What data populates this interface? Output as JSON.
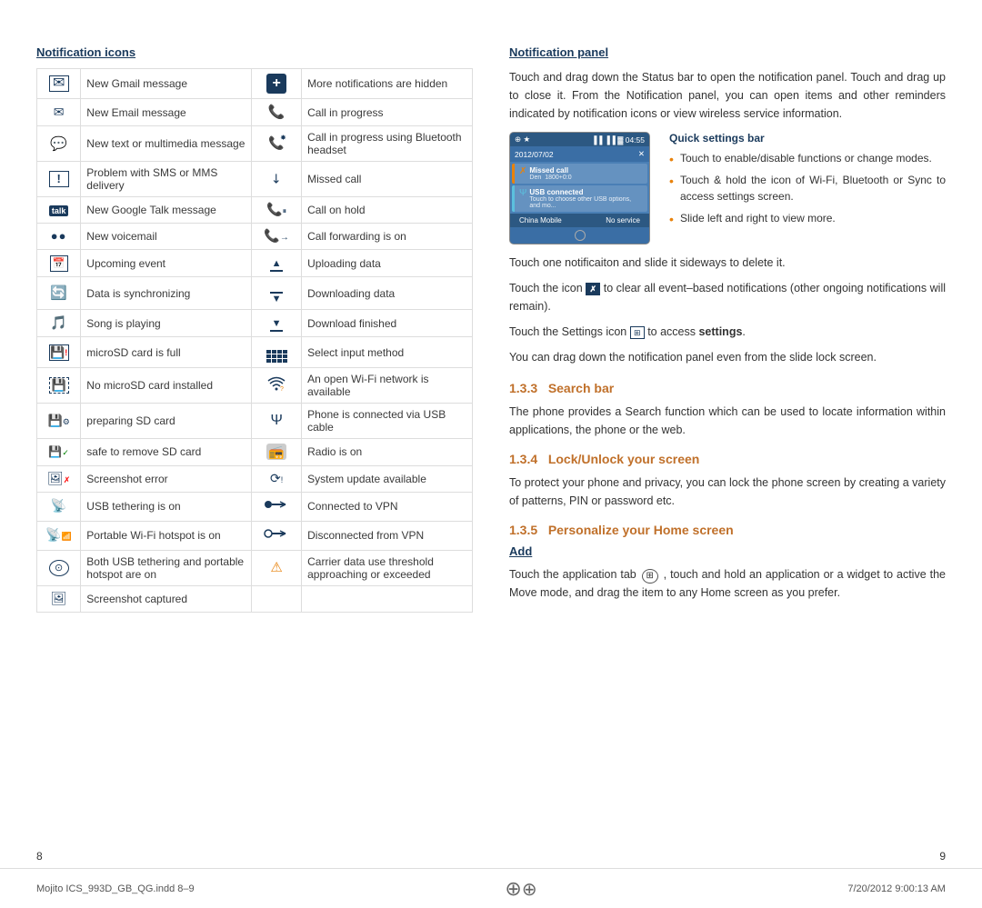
{
  "page": {
    "left_page_num": "8",
    "right_page_num": "9",
    "footer_text": "Mojito ICS_993D_GB_QG.indd   8–9",
    "footer_date": "7/20/2012   9:00:13 AM"
  },
  "left_section": {
    "title": "Notification icons",
    "rows": [
      {
        "icon_left": "✉",
        "label_left": "New Gmail message",
        "icon_right": "+",
        "label_right": "More notifications are hidden",
        "icon_right_style": "plus-circle"
      },
      {
        "icon_left": "✉",
        "label_left": "New Email message",
        "icon_right": "📞",
        "label_right": "Call in progress",
        "icon_right_style": "phone"
      },
      {
        "icon_left": "💬",
        "label_left": "New text or multimedia message",
        "icon_right": "📞",
        "label_right": "Call in progress using Bluetooth headset",
        "icon_right_style": "phone-bt"
      },
      {
        "icon_left": "❗",
        "label_left": "Problem with SMS or MMS delivery",
        "icon_right": "✗",
        "label_right": "Missed call",
        "icon_right_style": "missed"
      },
      {
        "icon_left": "talk",
        "label_left": "New Google Talk message",
        "icon_right": "📞",
        "label_right": "Call on hold",
        "icon_right_style": "hold"
      },
      {
        "icon_left": "●●",
        "label_left": "New voicemail",
        "icon_right": "📞",
        "label_right": "Call forwarding is on",
        "icon_right_style": "forward"
      },
      {
        "icon_left": "🗓",
        "label_left": "Upcoming event",
        "icon_right": "↑",
        "label_right": "Uploading data",
        "icon_right_style": "upload"
      },
      {
        "icon_left": "🔄",
        "label_left": "Data is synchronizing",
        "icon_right": "↓",
        "label_right": "Downloading data",
        "icon_right_style": "download"
      },
      {
        "icon_left": "🎵",
        "label_left": "Song is playing",
        "icon_right": "↓",
        "label_right": "Download finished",
        "icon_right_style": "download-done"
      },
      {
        "icon_left": "💾",
        "label_left": "microSD card is full",
        "icon_right": "⊞",
        "label_right": "Select input method",
        "icon_right_style": "keyboard"
      },
      {
        "icon_left": "💾",
        "label_left": "No microSD card installed",
        "icon_right": "📶",
        "label_right": "An open Wi-Fi network is available",
        "icon_right_style": "wifi"
      },
      {
        "icon_left": "💾",
        "label_left": "preparing SD card",
        "icon_right": "Ψ",
        "label_right": "Phone is connected via USB cable",
        "icon_right_style": "usb"
      },
      {
        "icon_left": "💾",
        "label_left": "safe to remove SD card",
        "icon_right": "📻",
        "label_right": "Radio is on",
        "icon_right_style": "radio"
      },
      {
        "icon_left": "🖼",
        "label_left": "Screenshot error",
        "icon_right": "🔄",
        "label_right": "System update available",
        "icon_right_style": "update"
      },
      {
        "icon_left": "📡",
        "label_left": "USB tethering is on",
        "icon_right": "⬤—",
        "label_right": "Connected to VPN",
        "icon_right_style": "vpn-on"
      },
      {
        "icon_left": "📡",
        "label_left": "Portable Wi-Fi hotspot is on",
        "icon_right": "⬤—",
        "label_right": "Disconnected from VPN",
        "icon_right_style": "vpn-off"
      },
      {
        "icon_left": "🔘",
        "label_left": "Both USB tethering and portable hotspot are on",
        "icon_right": "⚠",
        "label_right": "Carrier data use threshold approaching or exceeded",
        "icon_right_style": "warning"
      },
      {
        "icon_left": "🖼",
        "label_left": "Screenshot captured",
        "icon_right": "",
        "label_right": "",
        "icon_right_style": ""
      }
    ]
  },
  "right_section": {
    "title": "Notification panel",
    "intro": "Touch and drag down the Status bar to open the notification panel. Touch and drag up to close it. From the Notification panel, you can open items and other reminders indicated by notification icons or view wireless service information.",
    "phone_mockup": {
      "status_left": "⊕  ★",
      "status_right": "📶 📶 🔋 04:55",
      "date_row": "2012/07/02   ☰",
      "notif1_title": "Missed call",
      "notif1_sub": "Den",
      "notif1_time": "1800+0:0",
      "notif2_title": "USB connected",
      "notif2_sub": "Touch to choose other USB options, and mo...",
      "bottom_left": "China Mobile",
      "bottom_right": "No service"
    },
    "quick_settings": {
      "label": "Quick settings bar",
      "bullets": [
        "Touch to enable/disable functions or change modes.",
        "Touch & hold the icon of Wi-Fi, Bluetooth or Sync to access settings screen.",
        "Slide left and right to view more."
      ]
    },
    "info_texts": [
      "Touch one notificaiton and slide it sideways to delete it.",
      "Touch the icon  to clear all event–based notifications (other ongoing notifications will remain).",
      "Touch the Settings icon  to access settings.",
      "You can drag down the notification panel even from the slide lock screen."
    ],
    "section_133": {
      "num": "1.3.3",
      "title": "Search bar",
      "body": "The phone provides a Search function which can be used to locate information within applications, the phone or the web."
    },
    "section_134": {
      "num": "1.3.4",
      "title": "Lock/Unlock your screen",
      "body": "To protect your phone and privacy, you can lock the phone screen by creating a variety of patterns, PIN or password etc."
    },
    "section_135": {
      "num": "1.3.5",
      "title": "Personalize your Home screen",
      "add_label": "Add",
      "add_body": "Touch the application tab      ,  touch and hold an application or a widget to active the Move mode, and drag the item to any Home screen as you prefer."
    }
  }
}
